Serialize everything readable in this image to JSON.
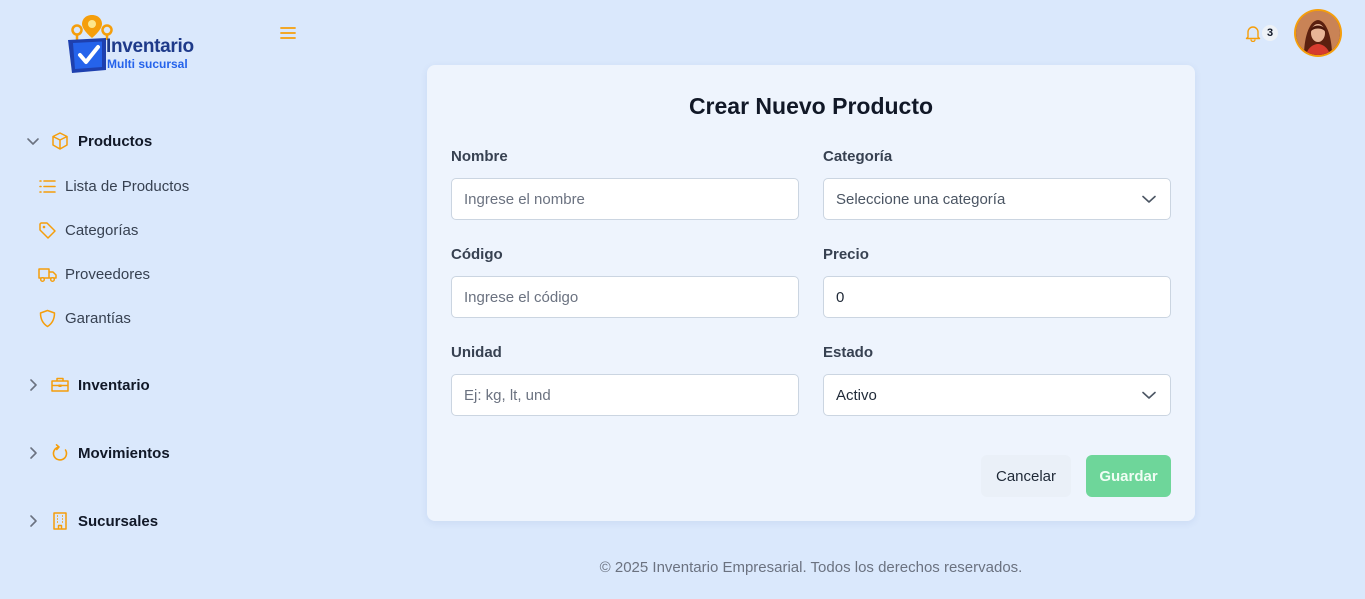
{
  "brand": {
    "title": "Inventario",
    "subtitle": "Multi sucursal",
    "accent": "#f59e0b",
    "primary": "#1e3a8a"
  },
  "header": {
    "menu_icon": "hamburger-icon",
    "notifications": {
      "icon": "bell-icon",
      "count": "3"
    },
    "avatar": "user-avatar"
  },
  "sidebar": {
    "sections": [
      {
        "label": "Productos",
        "icon": "box-icon",
        "expanded": true,
        "items": [
          {
            "label": "Lista de Productos",
            "icon": "list-icon"
          },
          {
            "label": "Categorías",
            "icon": "tag-icon"
          },
          {
            "label": "Proveedores",
            "icon": "truck-icon"
          },
          {
            "label": "Garantías",
            "icon": "shield-icon"
          }
        ]
      },
      {
        "label": "Inventario",
        "icon": "briefcase-icon",
        "expanded": false
      },
      {
        "label": "Movimientos",
        "icon": "refresh-icon",
        "expanded": false
      },
      {
        "label": "Sucursales",
        "icon": "building-icon",
        "expanded": false
      }
    ]
  },
  "form": {
    "title": "Crear Nuevo Producto",
    "fields": {
      "nombre": {
        "label": "Nombre",
        "placeholder": "Ingrese el nombre",
        "value": ""
      },
      "categoria": {
        "label": "Categoría",
        "selected": "Seleccione una categoría"
      },
      "codigo": {
        "label": "Código",
        "placeholder": "Ingrese el código",
        "value": ""
      },
      "precio": {
        "label": "Precio",
        "value": "0"
      },
      "unidad": {
        "label": "Unidad",
        "placeholder": "Ej: kg, lt, und",
        "value": ""
      },
      "estado": {
        "label": "Estado",
        "selected": "Activo"
      }
    },
    "cancel_label": "Cancelar",
    "save_label": "Guardar",
    "save_color": "#6ed69a"
  },
  "footer": {
    "text": "© 2025 Inventario Empresarial. Todos los derechos reservados."
  }
}
